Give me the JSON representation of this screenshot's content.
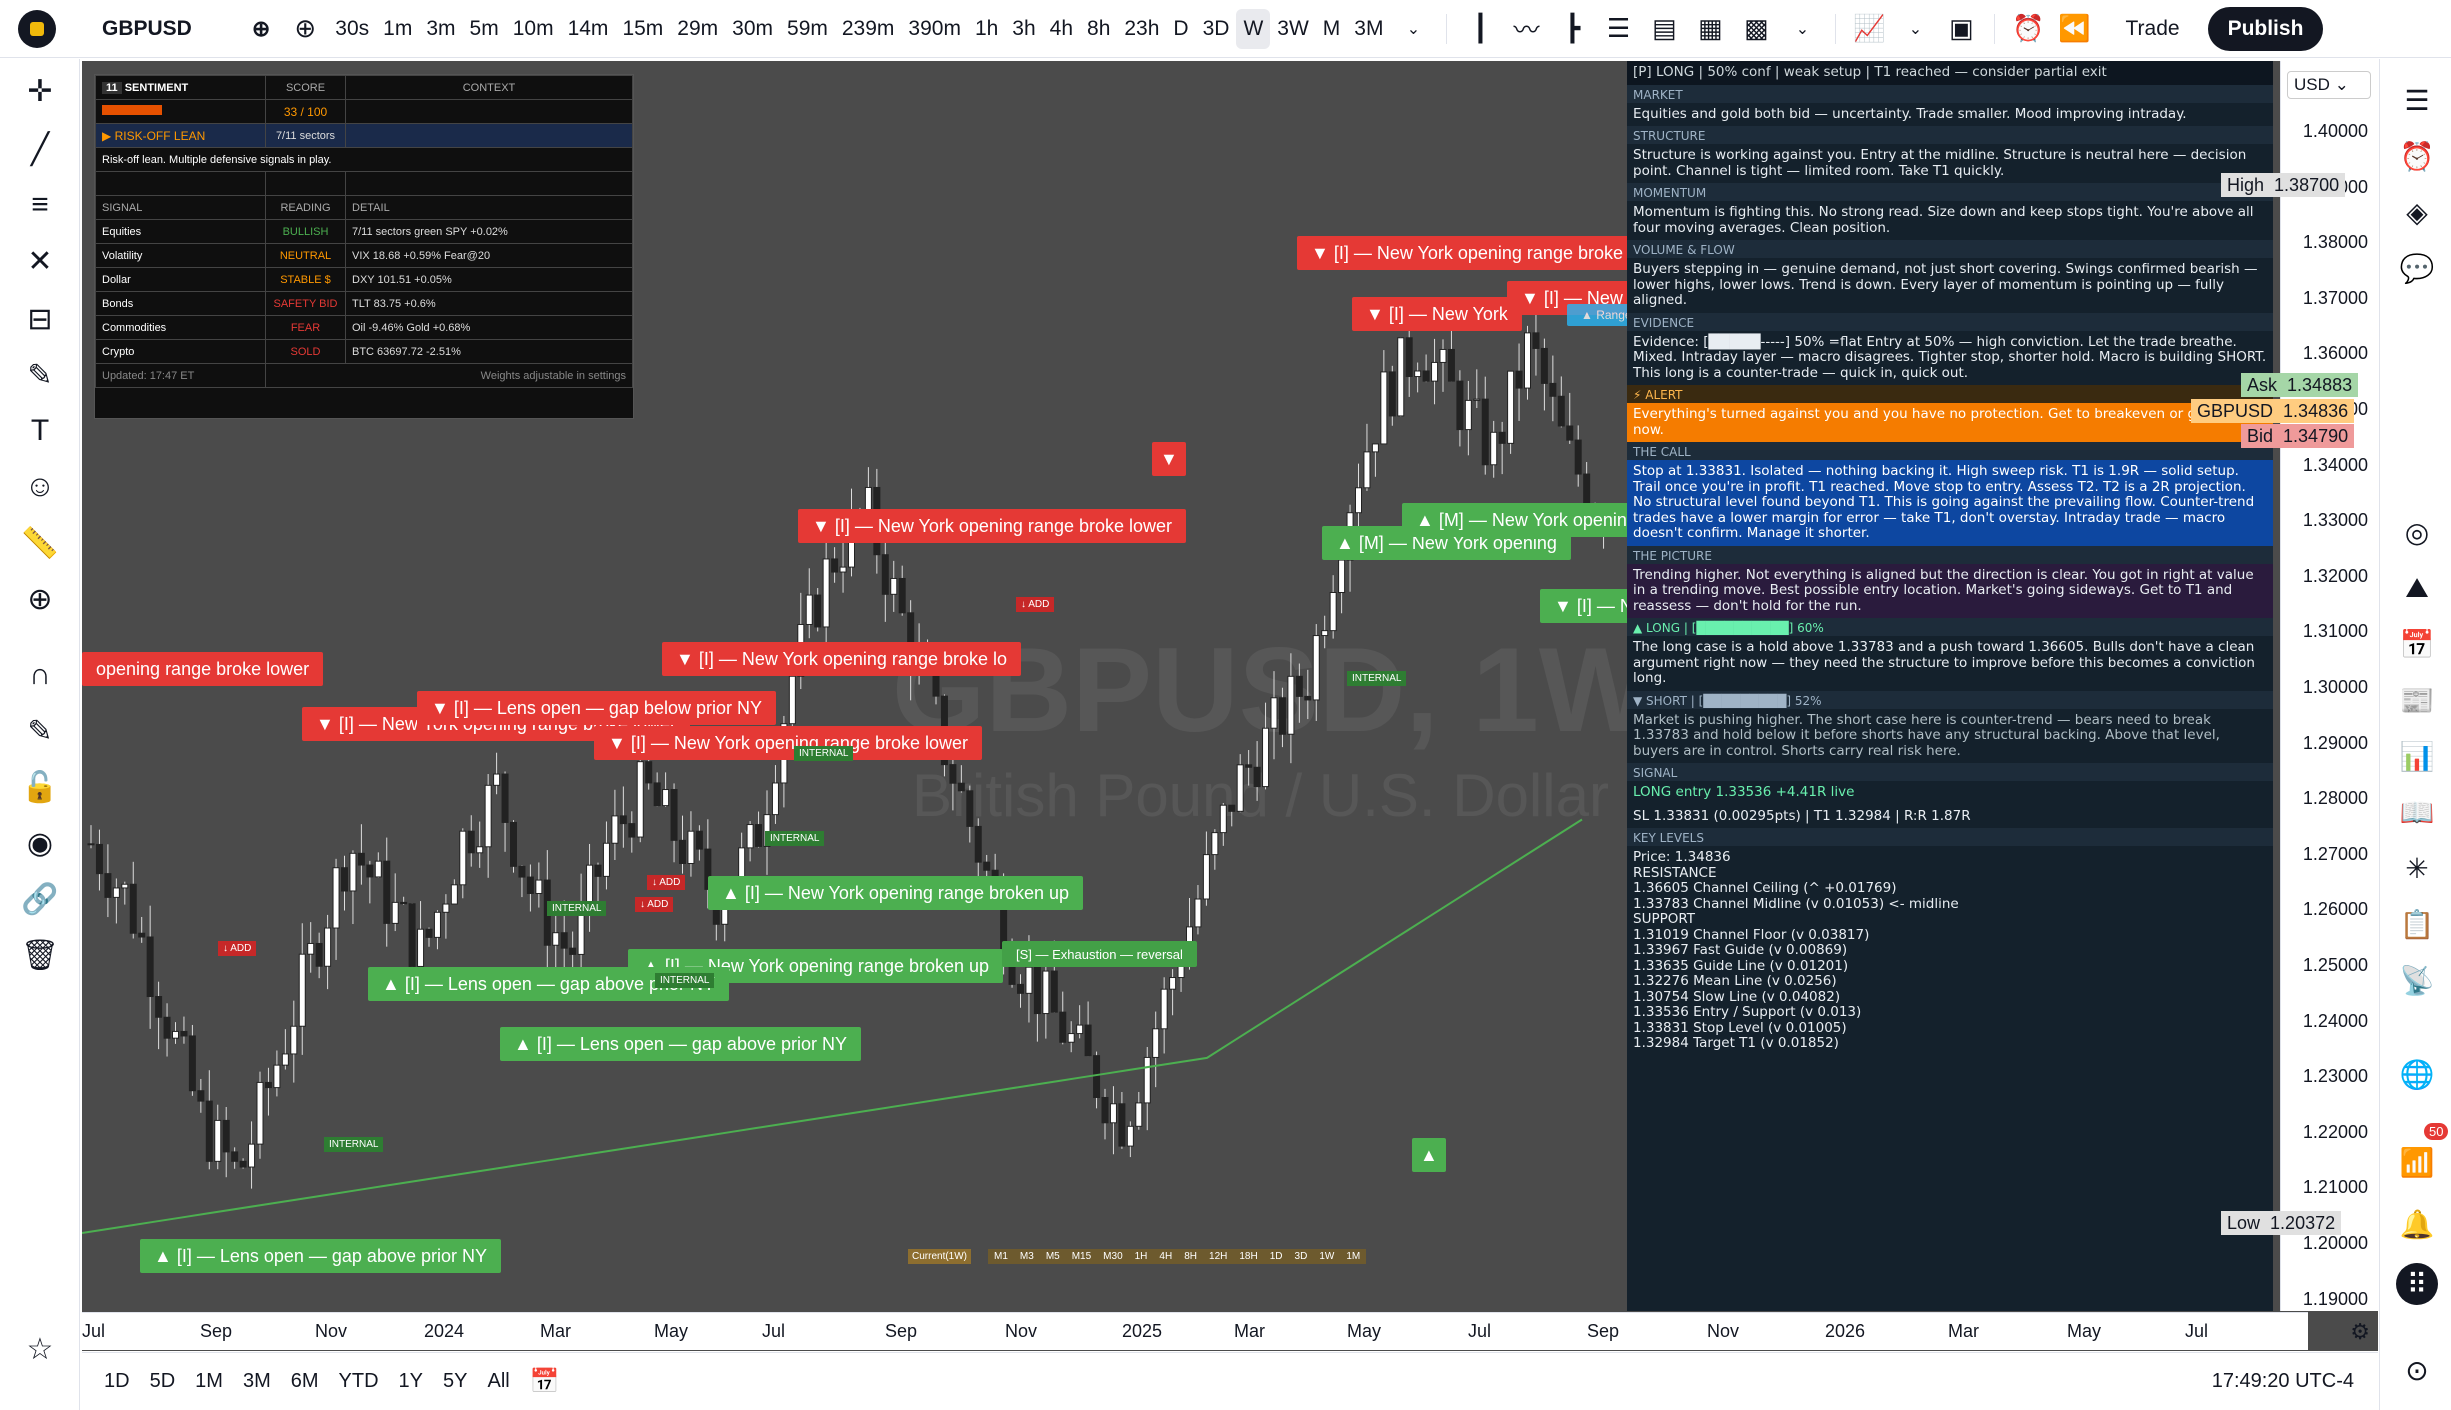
{
  "symbol": "GBPUSD",
  "timeframes": [
    "30s",
    "1m",
    "3m",
    "5m",
    "10m",
    "14m",
    "15m",
    "29m",
    "30m",
    "59m",
    "239m",
    "390m",
    "1h",
    "3h",
    "4h",
    "8h",
    "23h",
    "D",
    "3D",
    "W",
    "3W",
    "M",
    "3M"
  ],
  "active_tf": "W",
  "trade_label": "Trade",
  "publish_label": "Publish",
  "currency": "USD",
  "watermark": {
    "title": "GBPUSD, 1W",
    "subtitle": "British Pound / U.S. Dollar"
  },
  "sentiment": {
    "title": "SENTIMENT",
    "badge": "11",
    "col_score": "SCORE",
    "col_context": "CONTEXT",
    "score": "33 / 100",
    "lean": "▶ RISK-OFF LEAN",
    "lean_ctx": "7/11 sectors",
    "note": "Risk-off lean. Multiple defensive signals in play.",
    "col_signal": "SIGNAL",
    "col_reading": "READING",
    "col_detail": "DETAIL",
    "rows": [
      {
        "signal": "Equities",
        "reading": "BULLISH",
        "detail": "7/11 sectors green  SPY +0.02%",
        "color": "#4caf50"
      },
      {
        "signal": "Volatility",
        "reading": "NEUTRAL",
        "detail": "VIX 18.68  +0.59%  Fear@20",
        "color": "#ff9800"
      },
      {
        "signal": "Dollar",
        "reading": "STABLE $",
        "detail": "DXY 101.51  +0.05%",
        "color": "#ff9800"
      },
      {
        "signal": "Bonds",
        "reading": "SAFETY BID",
        "detail": "TLT 83.75  +0.6%",
        "color": "#e53935"
      },
      {
        "signal": "Commodities",
        "reading": "FEAR",
        "detail": "Oil -9.46%  Gold +0.68%",
        "color": "#e53935"
      },
      {
        "signal": "Crypto",
        "reading": "SOLD",
        "detail": "BTC 63697.72  -2.51%",
        "color": "#e53935"
      }
    ],
    "updated": "Updated: 17:47 ET",
    "weights": "Weights adjustable in settings"
  },
  "labels": {
    "ny_lower": "▼ [I] — New York opening range broke lower",
    "ny_lower_short": "▼ [I] — New York opening range broke lo",
    "ny_up": "▲ [I] — New York opening range broken up",
    "gap_above": "▲ [I] — Lens open — gap above prior NY",
    "gap_below": "▼ [I] — Lens open — gap below prior NY",
    "range_lower": "opening range broke lower",
    "exhaustion": "[S] — Exhaustion — reversal",
    "internal": "INTERNAL",
    "add": "↓ ADD",
    "ny_r": "▼ [I] — New York",
    "ny_open_m": "▲ [M] — New York opening",
    "range_badge": "▲ Range"
  },
  "panel": {
    "top": "[P] LONG  |  50% conf  |  weak setup  |  T1 reached — consider partial exit",
    "market_h": "MARKET",
    "market": "Equities and gold both bid — uncertainty. Trade smaller. Mood improving intraday.",
    "structure_h": "STRUCTURE",
    "structure": "Structure is working against you. Entry at the midline. Structure is neutral here — decision point. Channel is tight — limited room. Take T1 quickly.",
    "momentum_h": "MOMENTUM",
    "momentum": "Momentum is fighting this. No strong read. Size down and keep stops tight. You're above all four moving averages. Clean position.",
    "volume_h": "VOLUME & FLOW",
    "volume": "Buyers stepping in — genuine demand, not just short covering. Swings confirmed bearish — lower highs, lower lows. Trend is down. Every layer of momentum is pointing up — fully aligned.",
    "evidence_h": "EVIDENCE",
    "evidence": "Evidence: [█████-----] 50% =flat Entry at 50% — high conviction. Let the trade breathe.  Mixed. Intraday layer — macro disagrees. Tighter stop, shorter hold. Macro is building SHORT. This long is a counter-trade — quick in, quick out.",
    "alert_h": "⚡ ALERT",
    "alert": "Everything's turned against you and you have no protection. Get to breakeven or get out now.",
    "call_h": "THE CALL",
    "call": "Stop at 1.33831. Isolated — nothing backing it. High sweep risk. T1 is 1.9R — solid setup. Trail once you're in profit. T1 reached. Move stop to entry. Assess T2. T2 is a 2R projection. No structural level found beyond T1. This is going against the prevailing flow. Counter-trend trades have a lower margin for error — take T1, don't overstay. Intraday trade — macro doesn't confirm. Manage it shorter.",
    "picture_h": "THE PICTURE",
    "picture": "Trending higher. Not everything is aligned but the direction is clear. You got in right at value in a trending move. Best possible entry location. Market's going sideways. Get to T1 and reassess — don't hold for the run.",
    "long_h": "▲ LONG  |  [██████████]  60%",
    "long": "The long case is a hold above 1.33783 and a push toward 1.36605. Bulls don't have a clean argument right now — they need the structure to improve before this becomes a conviction long.",
    "short_h": "▼ SHORT  |  [█████████]  52%",
    "short": "Market is pushing higher. The short case here is counter-trend — bears need to break 1.33783 and hold below it before shorts have any structural backing. Above that level, buyers are in control. Shorts carry real risk here.",
    "signal_h": "SIGNAL",
    "signal1": "LONG  entry 1.33536  +4.41R live",
    "signal2": "SL 1.33831  (0.00295pts)  |  T1 1.32984  |  R:R 1.87R",
    "levels_h": "KEY LEVELS",
    "levels": [
      "Price: 1.34836",
      " RESISTANCE ",
      "1.36605  Channel Ceiling  (^ +0.01769)",
      "1.33783  Channel Midline  (v 0.01053)  <- midline",
      " SUPPORT ",
      "1.31019  Channel Floor  (v 0.03817)",
      "1.33967  Fast Guide  (v 0.00869)",
      "1.33635  Guide Line  (v 0.01201)",
      "1.32276  Mean Line  (v 0.0256)",
      "1.30754  Slow Line  (v 0.04082)",
      "1.33536  Entry / Support  (v 0.013)",
      "1.33831  Stop Level  (v 0.01005)",
      "1.32984  Target T1  (v 0.01852)"
    ]
  },
  "price_axis": [
    "1.40000",
    "1.39000",
    "1.38000",
    "1.37000",
    "1.36000",
    "1.35000",
    "1.34000",
    "1.33000",
    "1.32000",
    "1.31000",
    "1.30000",
    "1.29000",
    "1.28000",
    "1.27000",
    "1.26000",
    "1.25000",
    "1.24000",
    "1.23000",
    "1.22000",
    "1.21000",
    "1.20000",
    "1.19000"
  ],
  "price_tags": {
    "high_label": "High",
    "high": "1.38700",
    "ask_label": "Ask",
    "ask": "1.34883",
    "sym": "GBPUSD",
    "last": "1.34836",
    "bid_label": "Bid",
    "bid": "1.34790",
    "low_label": "Low",
    "low": "1.20372"
  },
  "time_axis": [
    "Jul",
    "Sep",
    "Nov",
    "2024",
    "Mar",
    "May",
    "Jul",
    "Sep",
    "Nov",
    "2025",
    "Mar",
    "May",
    "Jul",
    "Sep",
    "Nov",
    "2026",
    "Mar",
    "May",
    "Jul"
  ],
  "bottom": {
    "ranges": [
      "1D",
      "5D",
      "1M",
      "3M",
      "6M",
      "YTD",
      "1Y",
      "5Y",
      "All"
    ],
    "clock": "17:49:20 UTC-4"
  },
  "strip": {
    "current": "Current(1W)",
    "tfs": [
      "M1",
      "M3",
      "M5",
      "M15",
      "M30",
      "1H",
      "4H",
      "8H",
      "12H",
      "18H",
      "1D",
      "3D",
      "1W",
      "1M"
    ]
  },
  "notif_count": "50",
  "colors": {
    "bear": "#e53935",
    "bull": "#4caf50",
    "bg": "#4b4b4b",
    "panel": "#14212c"
  }
}
